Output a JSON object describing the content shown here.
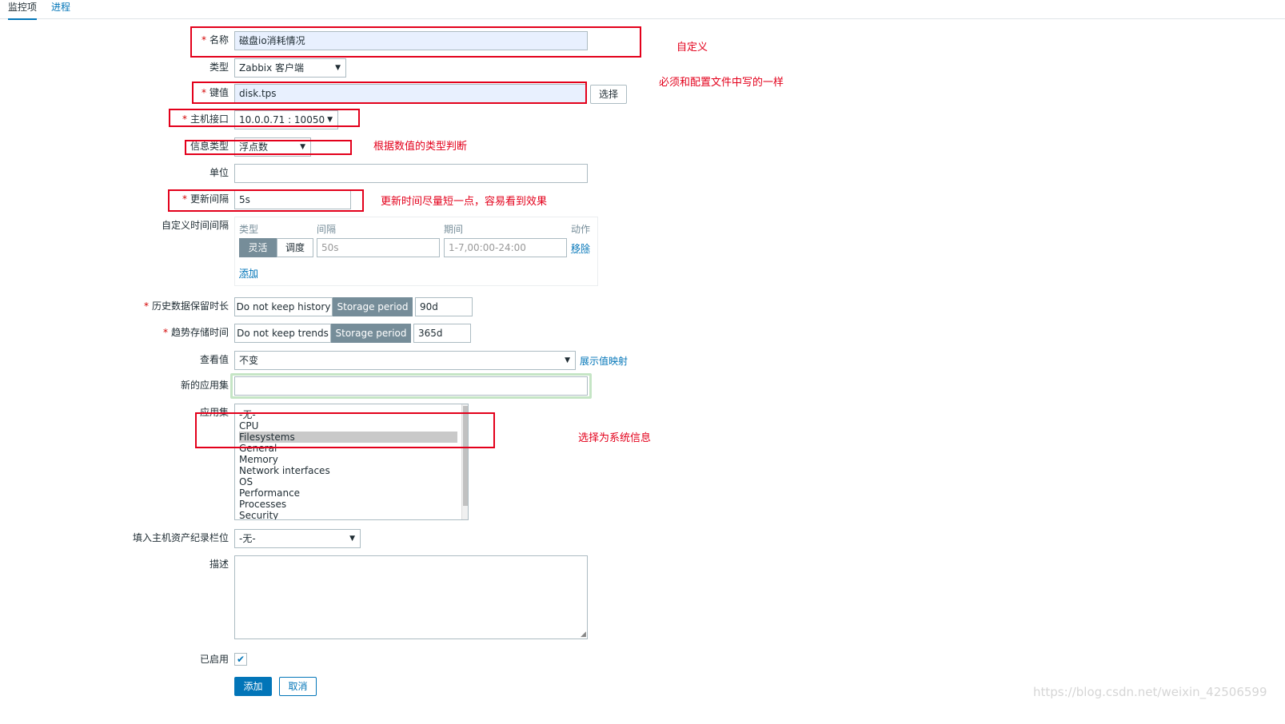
{
  "tabs": [
    {
      "label": "监控项"
    },
    {
      "label": "进程"
    }
  ],
  "form": {
    "name": {
      "label": "名称",
      "value": "磁盘io消耗情况"
    },
    "type": {
      "label": "类型",
      "value": "Zabbix 客户端"
    },
    "key": {
      "label": "键值",
      "value": "disk.tps",
      "select_button": "选择"
    },
    "interface": {
      "label": "主机接口",
      "value": "10.0.0.71 : 10050"
    },
    "info_type": {
      "label": "信息类型",
      "value": "浮点数"
    },
    "units": {
      "label": "单位",
      "value": ""
    },
    "interval": {
      "label": "更新间隔",
      "value": "5s"
    },
    "custom_intervals": {
      "label": "自定义时间间隔",
      "headers": [
        "类型",
        "间隔",
        "期间",
        "动作"
      ],
      "flexible": "灵活",
      "scheduling": "调度",
      "interval_placeholder": "50s",
      "period_placeholder": "1-7,00:00-24:00",
      "remove": "移除",
      "add": "添加"
    },
    "history": {
      "label": "历史数据保留时长",
      "option_off": "Do not keep history",
      "option_on": "Storage period",
      "value": "90d"
    },
    "trends": {
      "label": "趋势存储时间",
      "option_off": "Do not keep trends",
      "option_on": "Storage period",
      "value": "365d"
    },
    "valuemap": {
      "label": "查看值",
      "value": "不变",
      "link": "展示值映射"
    },
    "new_application": {
      "label": "新的应用集",
      "value": ""
    },
    "applications": {
      "label": "应用集",
      "items": [
        "-无-",
        "CPU",
        "Filesystems",
        "General",
        "Memory",
        "Network interfaces",
        "OS",
        "Performance",
        "Processes",
        "Security"
      ],
      "selected": "Filesystems"
    },
    "inventory": {
      "label": "填入主机资产纪录栏位",
      "value": "-无-"
    },
    "description": {
      "label": "描述",
      "value": ""
    },
    "enabled": {
      "label": "已启用",
      "checked": true
    },
    "add_button": "添加",
    "cancel_button": "取消"
  },
  "annotations": {
    "custom": "自定义",
    "same_as_config": "必须和配置文件中写的一样",
    "by_value_type": "根据数值的类型判断",
    "short_interval": "更新时间尽量短一点，容易看到效果",
    "choose_system": "选择为系统信息"
  },
  "watermark": "https://blog.csdn.net/weixin_42506599",
  "colors": {
    "accent": "#0275b8",
    "annotation": "#e3001b",
    "selected_row": "#c9c9c9",
    "segment_on": "#768d99"
  }
}
